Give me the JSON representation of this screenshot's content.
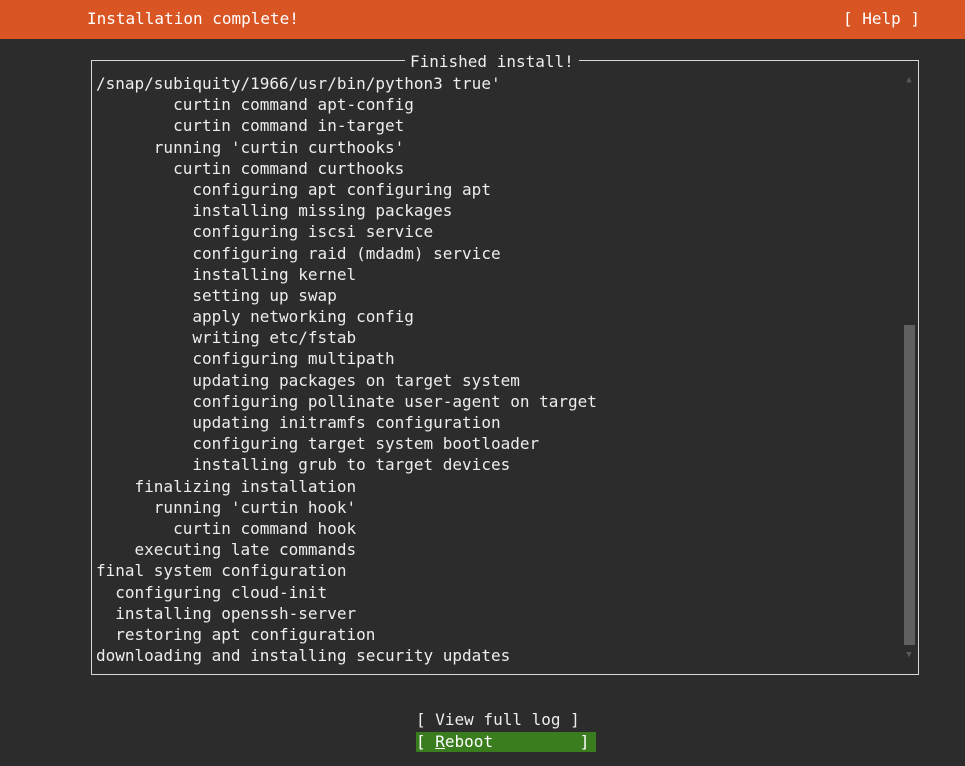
{
  "header": {
    "title": "Installation complete!",
    "help_label": "[ Help ]"
  },
  "panel": {
    "title": "Finished install!",
    "log_lines": [
      "/snap/subiquity/1966/usr/bin/python3 true'",
      "        curtin command apt-config",
      "        curtin command in-target",
      "      running 'curtin curthooks'",
      "        curtin command curthooks",
      "          configuring apt configuring apt",
      "          installing missing packages",
      "          configuring iscsi service",
      "          configuring raid (mdadm) service",
      "          installing kernel",
      "          setting up swap",
      "          apply networking config",
      "          writing etc/fstab",
      "          configuring multipath",
      "          updating packages on target system",
      "          configuring pollinate user-agent on target",
      "          updating initramfs configuration",
      "          configuring target system bootloader",
      "          installing grub to target devices",
      "    finalizing installation",
      "      running 'curtin hook'",
      "        curtin command hook",
      "    executing late commands",
      "final system configuration",
      "  configuring cloud-init",
      "  installing openssh-server",
      "  restoring apt configuration",
      "downloading and installing security updates"
    ],
    "scroll_up_glyph": "▲",
    "scroll_down_glyph": "▼"
  },
  "buttons": {
    "view_log_label": "[ View full log ]",
    "reboot_open": "[ ",
    "reboot_hotkey": "R",
    "reboot_rest": "eboot         ]"
  },
  "colors": {
    "header_bg": "#d95524",
    "reboot_bg": "#3a7d1f",
    "background": "#2c2c2c"
  }
}
